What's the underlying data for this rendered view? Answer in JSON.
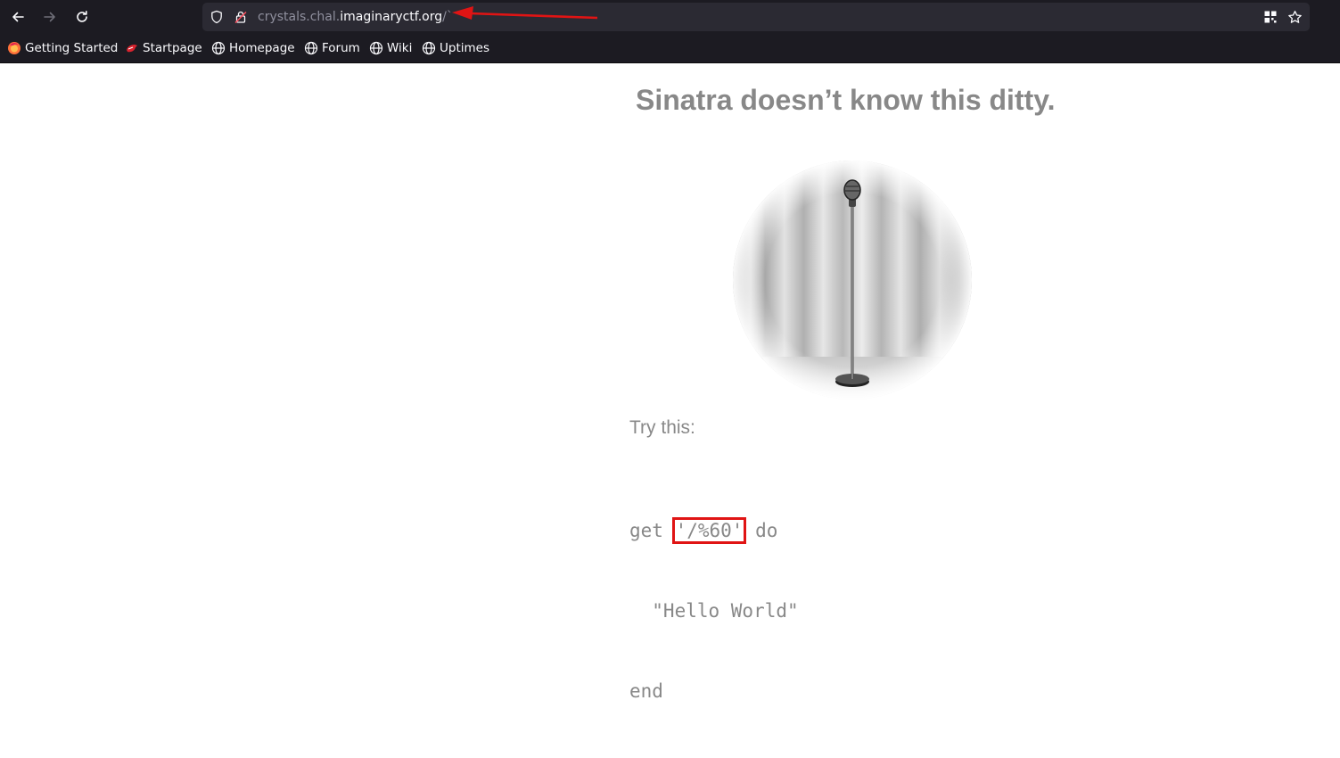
{
  "browser": {
    "nav": {
      "back_icon": "back-arrow-icon",
      "forward_icon": "forward-arrow-icon",
      "reload_icon": "reload-icon"
    },
    "urlbar": {
      "host_prefix": "crystals.chal.",
      "host_domain": "imaginaryctf.org",
      "path": "/`",
      "shield_icon": "tracking-protection-shield-icon",
      "lock_icon": "insecure-lock-icon",
      "actions": [
        "extensions-grid-icon",
        "bookmark-star-icon"
      ]
    },
    "bookmarks": [
      {
        "label": "Getting Started",
        "icon": "firefox-icon"
      },
      {
        "label": "Startpage",
        "icon": "startpage-icon"
      },
      {
        "label": "Homepage",
        "icon": "globe-icon"
      },
      {
        "label": "Forum",
        "icon": "globe-icon"
      },
      {
        "label": "Wiki",
        "icon": "globe-icon"
      },
      {
        "label": "Uptimes",
        "icon": "globe-icon"
      }
    ]
  },
  "page": {
    "headline": "Sinatra doesn’t know this ditty.",
    "image": "microphone-on-stage",
    "try_label": "Try this:",
    "code": {
      "line1_start": "get ",
      "line1_route": "'/%60'",
      "line1_end": " do",
      "line2": "  \"Hello World\"",
      "line3": "end"
    }
  },
  "colors": {
    "chrome_bg": "#1c1b22",
    "urlbar_bg": "#2b2a33",
    "text_gray": "#888888",
    "annotation_red": "#e01414"
  }
}
